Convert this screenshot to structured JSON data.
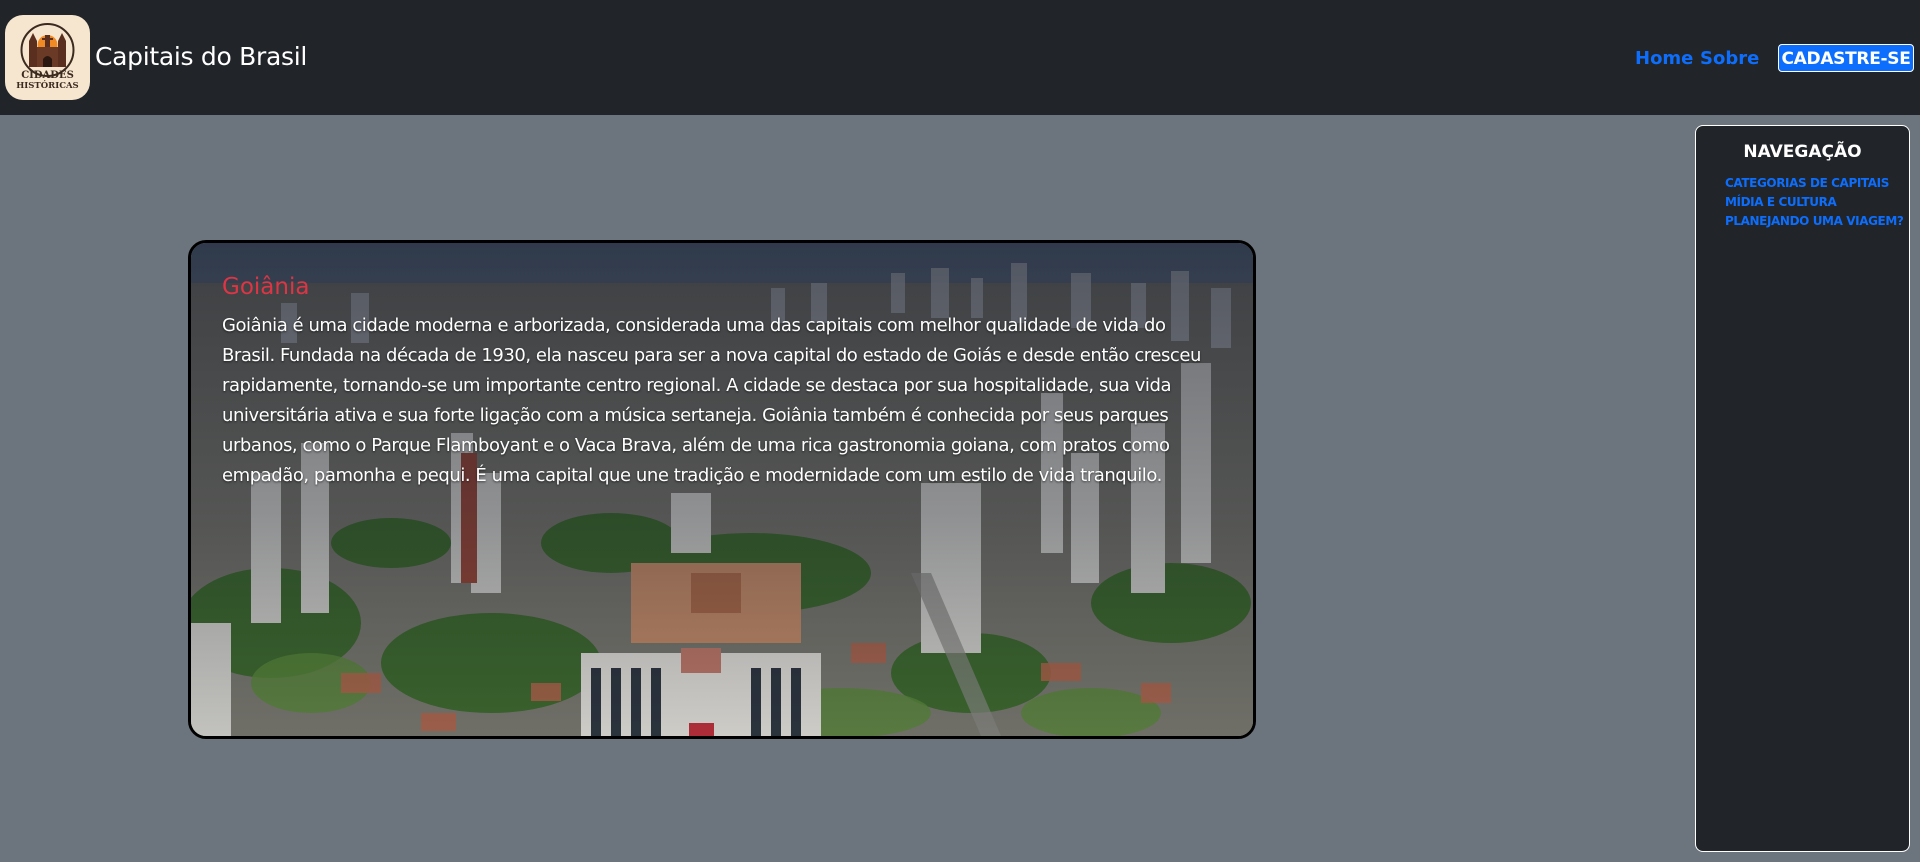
{
  "header": {
    "logo_text_line1": "CIDADES",
    "logo_text_line2": "HISTÓRICAS",
    "brand": "Capitais do Brasil",
    "nav": [
      {
        "label": "Home"
      },
      {
        "label": "Sobre"
      }
    ],
    "signup_label": "CADASTRE-SE"
  },
  "card": {
    "title": "Goiânia",
    "text": "Goiânia é uma cidade moderna e arborizada, considerada uma das capitais com melhor qualidade de vida do Brasil. Fundada na década de 1930, ela nasceu para ser a nova capital do estado de Goiás e desde então cresceu rapidamente, tornando-se um importante centro regional. A cidade se destaca por sua hospitalidade, sua vida universitária ativa e sua forte ligação com a música sertaneja. Goiânia também é conhecida por seus parques urbanos, como o Parque Flamboyant e o Vaca Brava, além de uma rica gastronomia goiana, com pratos como empadão, pamonha e pequi. É uma capital que une tradição e modernidade com um estilo de vida tranquilo."
  },
  "sidebar": {
    "title": "NAVEGAÇÃO",
    "items": [
      {
        "label": "CATEGORIAS DE CAPITAIS"
      },
      {
        "label": "MÍDIA E CULTURA"
      },
      {
        "label": "PLANEJANDO UMA VIAGEM?"
      }
    ]
  },
  "colors": {
    "page_bg": "#6c757d",
    "navbar_bg": "#212529",
    "accent": "#0d6efd",
    "card_title": "#dc3545"
  }
}
